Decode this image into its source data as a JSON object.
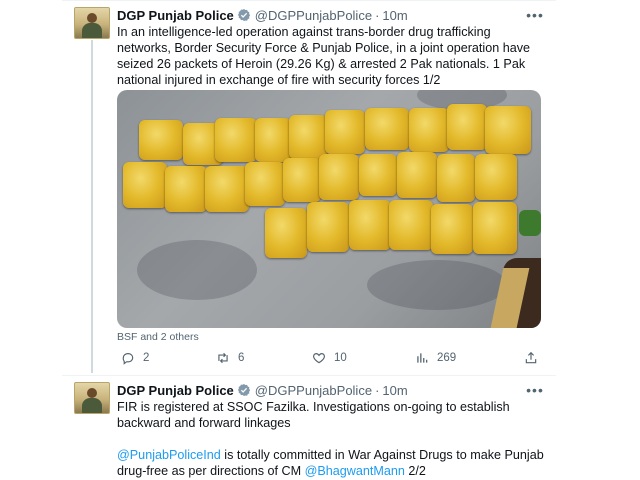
{
  "tweets": [
    {
      "author": "DGP Punjab Police",
      "handle": "@DGPPunjabPolice",
      "separator": "·",
      "time": "10m",
      "text": "In an intelligence-led operation against trans-border drug trafficking networks, Border Security Force & Punjab Police, in a joint operation have seized 26 packets of Heroin (29.26 Kg) & arrested 2 Pak nationals. 1 Pak national injured in exchange of fire with security forces 1/2",
      "media_tags": "BSF and 2 others",
      "actions": {
        "replies": "2",
        "retweets": "6",
        "likes": "10",
        "views": "269"
      }
    },
    {
      "author": "DGP Punjab Police",
      "handle": "@DGPPunjabPolice",
      "separator": "·",
      "time": "10m",
      "text_p1": "FIR is registered at SSOC Fazilka. Investigations on-going to establish backward and forward linkages",
      "text_mention1": "@PunjabPoliceInd",
      "text_p2": " is totally committed in War Against Drugs to make Punjab drug-free as per directions of CM ",
      "text_mention2": "@BhagwantMann",
      "text_p3": " 2/2"
    }
  ],
  "icons": {
    "verified": "verified-badge-icon",
    "more": "more-options-icon",
    "reply": "reply-icon",
    "retweet": "retweet-icon",
    "like": "like-icon",
    "views": "views-icon",
    "share": "share-icon"
  },
  "colors": {
    "accent": "#1d9bf0",
    "secondary_text": "#536471",
    "primary_text": "#0f1419",
    "border": "#eff3f4"
  }
}
